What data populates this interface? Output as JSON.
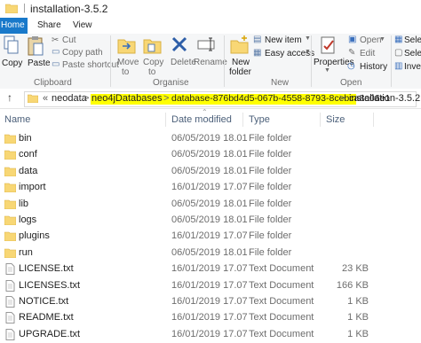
{
  "window": {
    "title": "installation-3.5.2"
  },
  "tabs": [
    {
      "label": "Home"
    },
    {
      "label": "Share"
    },
    {
      "label": "View"
    }
  ],
  "ribbon": {
    "clipboard": {
      "copy": "Copy",
      "paste": "Paste",
      "cut": "Cut",
      "copy_path": "Copy path",
      "paste_shortcut": "Paste shortcut",
      "group": "Clipboard"
    },
    "organise": {
      "move_to_1": "Move",
      "move_to_2": "to",
      "copy_to_1": "Copy",
      "copy_to_2": "to",
      "delete": "Delete",
      "rename": "Rename",
      "group": "Organise"
    },
    "new": {
      "new_folder_1": "New",
      "new_folder_2": "folder",
      "new_item": "New item",
      "easy_access": "Easy access",
      "group": "New"
    },
    "open": {
      "properties": "Properties",
      "open": "Open",
      "edit": "Edit",
      "history": "History",
      "group": "Open"
    },
    "select": {
      "select_all": "Select",
      "select_none": "Select",
      "invert": "Invert"
    }
  },
  "address": {
    "prefix": "«",
    "crumbs": [
      "neodata",
      "neo4jDatabases",
      "database-876bd4d5-067b-4558-8793-8cebca8e06e1",
      "installation-3.5.2"
    ],
    "separator": ">"
  },
  "columns": {
    "name": "Name",
    "date": "Date modified",
    "type": "Type",
    "size": "Size"
  },
  "files": [
    {
      "name": "bin",
      "date": "06/05/2019 18.01",
      "type": "File folder",
      "size": "",
      "kind": "folder"
    },
    {
      "name": "conf",
      "date": "06/05/2019 18.01",
      "type": "File folder",
      "size": "",
      "kind": "folder"
    },
    {
      "name": "data",
      "date": "06/05/2019 18.01",
      "type": "File folder",
      "size": "",
      "kind": "folder"
    },
    {
      "name": "import",
      "date": "16/01/2019 17.07",
      "type": "File folder",
      "size": "",
      "kind": "folder"
    },
    {
      "name": "lib",
      "date": "06/05/2019 18.01",
      "type": "File folder",
      "size": "",
      "kind": "folder"
    },
    {
      "name": "logs",
      "date": "06/05/2019 18.01",
      "type": "File folder",
      "size": "",
      "kind": "folder"
    },
    {
      "name": "plugins",
      "date": "16/01/2019 17.07",
      "type": "File folder",
      "size": "",
      "kind": "folder"
    },
    {
      "name": "run",
      "date": "06/05/2019 18.01",
      "type": "File folder",
      "size": "",
      "kind": "folder"
    },
    {
      "name": "LICENSE.txt",
      "date": "16/01/2019 17.07",
      "type": "Text Document",
      "size": "23 KB",
      "kind": "text"
    },
    {
      "name": "LICENSES.txt",
      "date": "16/01/2019 17.07",
      "type": "Text Document",
      "size": "166 KB",
      "kind": "text"
    },
    {
      "name": "NOTICE.txt",
      "date": "16/01/2019 17.07",
      "type": "Text Document",
      "size": "1 KB",
      "kind": "text"
    },
    {
      "name": "README.txt",
      "date": "16/01/2019 17.07",
      "type": "Text Document",
      "size": "1 KB",
      "kind": "text"
    },
    {
      "name": "UPGRADE.txt",
      "date": "16/01/2019 17.07",
      "type": "Text Document",
      "size": "1 KB",
      "kind": "text"
    }
  ],
  "colors": {
    "accent": "#1979ca",
    "highlight": "#ffff00",
    "folder": "#f8d775"
  }
}
